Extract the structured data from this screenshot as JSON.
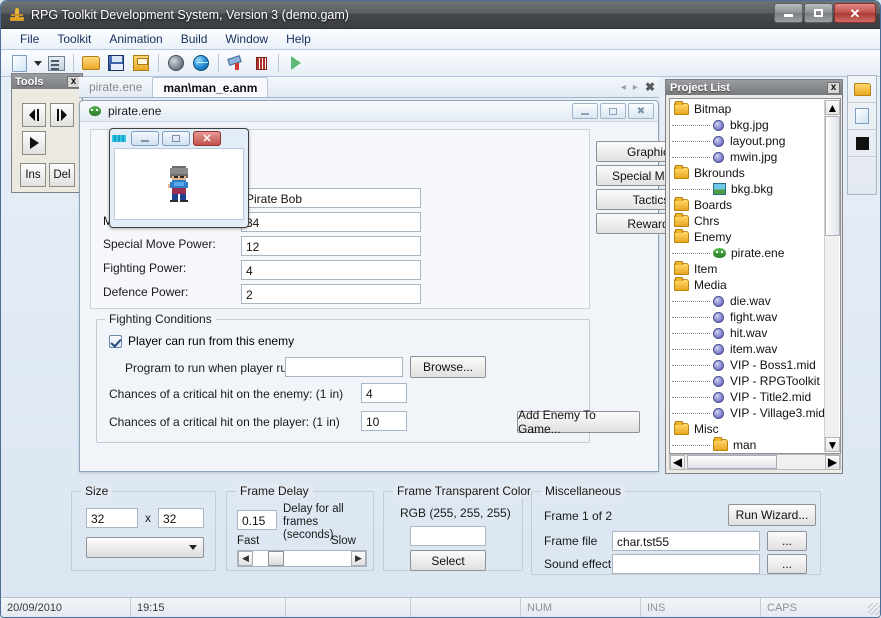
{
  "window": {
    "title": "RPG Toolkit Development System, Version 3 (demo.gam)",
    "minimize_label": "",
    "maximize_label": "",
    "close_label": "✕"
  },
  "menubar": {
    "items": [
      "File",
      "Toolkit",
      "Animation",
      "Build",
      "Window",
      "Help"
    ]
  },
  "toolbar": {
    "icons": [
      "new-document-icon",
      "dropdown-arrow-icon",
      "properties-icon",
      "open-folder-icon",
      "save-icon",
      "save-all-icon",
      "disk-icon",
      "globe-icon",
      "wizard-icon",
      "bars-icon",
      "run-icon"
    ]
  },
  "tools_palette": {
    "title": "Tools",
    "close_label": "x",
    "buttons": [
      "step-back",
      "step-forward",
      "play",
      "Ins",
      "Del"
    ],
    "ins_label": "Ins",
    "del_label": "Del"
  },
  "tabs": {
    "items": [
      {
        "label": "pirate.ene",
        "active": false
      },
      {
        "label": "man\\man_e.anm",
        "active": true
      }
    ],
    "scroll_left": "◂",
    "scroll_right": "▸",
    "close": "✖"
  },
  "mdi_child": {
    "title": "pirate.ene",
    "minimize_label": "",
    "maximize_label": "",
    "close_label": "✖",
    "preview_window": {
      "minimize_label": "",
      "maximize_label": "",
      "close_label": "✕"
    },
    "fields": [
      {
        "label": "Max Health Limit:",
        "value": "34",
        "occluded": true
      },
      {
        "label": "Special Move Power:",
        "value": "12",
        "occluded": false
      },
      {
        "label": "Fighting Power:",
        "value": "4",
        "occluded": false
      },
      {
        "label": "Defence Power:",
        "value": "2",
        "occluded": false
      }
    ],
    "name_field": {
      "value": "Pirate Bob",
      "placeholder": ""
    },
    "side_buttons": [
      "Graphics...",
      "Special Moves...",
      "Tactics...",
      "Rewards..."
    ],
    "fighting_conditions": {
      "title": "Fighting Conditions",
      "run_checkbox_label": "Player can run from this enemy",
      "run_checkbox_checked": true,
      "program_label": "Program to run when player runs:",
      "program_value": "",
      "browse_label": "Browse...",
      "crit_enemy_label": "Chances of a critical hit on the enemy: (1 in)",
      "crit_enemy_value": "4",
      "crit_player_label": "Chances of a critical hit on the player: (1 in)",
      "crit_player_value": "10"
    },
    "add_enemy_label": "Add Enemy To Game..."
  },
  "project_list": {
    "title": "Project List",
    "close_label": "x",
    "items": [
      {
        "label": "Bitmap",
        "type": "folder",
        "depth": 0
      },
      {
        "label": "bkg.jpg",
        "type": "gem",
        "depth": 1
      },
      {
        "label": "layout.png",
        "type": "gem",
        "depth": 1
      },
      {
        "label": "mwin.jpg",
        "type": "gem",
        "depth": 1
      },
      {
        "label": "Bkrounds",
        "type": "folder",
        "depth": 0
      },
      {
        "label": "bkg.bkg",
        "type": "bkg",
        "depth": 1
      },
      {
        "label": "Boards",
        "type": "folder",
        "depth": 0
      },
      {
        "label": "Chrs",
        "type": "folder",
        "depth": 0
      },
      {
        "label": "Enemy",
        "type": "folder",
        "depth": 0
      },
      {
        "label": "pirate.ene",
        "type": "enemy",
        "depth": 1
      },
      {
        "label": "Item",
        "type": "folder",
        "depth": 0
      },
      {
        "label": "Media",
        "type": "folder",
        "depth": 0
      },
      {
        "label": "die.wav",
        "type": "gem",
        "depth": 1
      },
      {
        "label": "fight.wav",
        "type": "gem",
        "depth": 1
      },
      {
        "label": "hit.wav",
        "type": "gem",
        "depth": 1
      },
      {
        "label": "item.wav",
        "type": "gem",
        "depth": 1
      },
      {
        "label": "VIP - Boss1.mid",
        "type": "gem",
        "depth": 1
      },
      {
        "label": "VIP - RPGToolkit Fo",
        "type": "gem",
        "depth": 1
      },
      {
        "label": "VIP - Title2.mid",
        "type": "gem",
        "depth": 1
      },
      {
        "label": "VIP - Village3.mid",
        "type": "gem",
        "depth": 1
      },
      {
        "label": "Misc",
        "type": "folder",
        "depth": 0
      },
      {
        "label": "man",
        "type": "folder",
        "depth": 1
      }
    ]
  },
  "icon_strip": {
    "icons": [
      "folder-icon",
      "document-icon",
      "black-square-icon"
    ]
  },
  "animation_panel": {
    "size": {
      "title": "Size",
      "width_value": "32",
      "separator": "x",
      "height_value": "32",
      "combo_value": ""
    },
    "frame_delay": {
      "title": "Frame Delay",
      "delay_value": "0.15",
      "description": "Delay for all frames (seconds)",
      "fast_label": "Fast",
      "slow_label": "Slow"
    },
    "transparent_color": {
      "title": "Frame Transparent Color",
      "rgb_label": "RGB (255, 255, 255)",
      "swatch_value": "#ffffff",
      "select_label": "Select"
    },
    "miscellaneous": {
      "title": "Miscellaneous",
      "frame_counter": "Frame 1 of 2",
      "run_wizard_label": "Run Wizard...",
      "frame_file_label": "Frame file",
      "frame_file_value": "char.tst55",
      "frame_file_browse": "...",
      "sound_effect_label": "Sound effect",
      "sound_effect_value": "",
      "sound_effect_browse": "..."
    }
  },
  "statusbar": {
    "cells": [
      "20/09/2010",
      "19:15",
      "",
      "",
      "NUM",
      "INS",
      "CAPS"
    ]
  },
  "colors": {
    "titlebar": "#44474b",
    "close_button": "#c2504a",
    "accent_blue": "#3f6a96",
    "folder_yellow": "#e9a71f",
    "panel_bg": "#f1f4f8"
  }
}
